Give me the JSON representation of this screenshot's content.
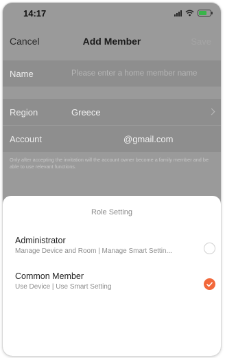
{
  "status_bar": {
    "time": "14:17",
    "battery_color": "#39b54a",
    "battery_level": 0.7
  },
  "nav": {
    "cancel": "Cancel",
    "title": "Add Member",
    "save": "Save"
  },
  "form": {
    "name_label": "Name",
    "name_placeholder": "Please enter a home member name",
    "region_label": "Region",
    "region_value": "Greece",
    "account_label": "Account",
    "account_value": "@gmail.com",
    "hint": "Only after accepting the invitation will the account owner become a family member and be able to use relevant functions."
  },
  "role_sheet": {
    "title": "Role Setting",
    "roles": [
      {
        "name": "Administrator",
        "description": "Manage Device and Room | Manage Smart Settin...",
        "selected": false
      },
      {
        "name": "Common Member",
        "description": "Use Device | Use Smart Setting",
        "selected": true
      }
    ],
    "accent_color": "#f2683b"
  },
  "icons": {
    "signal": "cellular-signal-icon",
    "wifi": "wifi-icon",
    "battery": "battery-charging-icon",
    "chevron": "chevron-right-icon",
    "check": "checkmark-icon"
  }
}
